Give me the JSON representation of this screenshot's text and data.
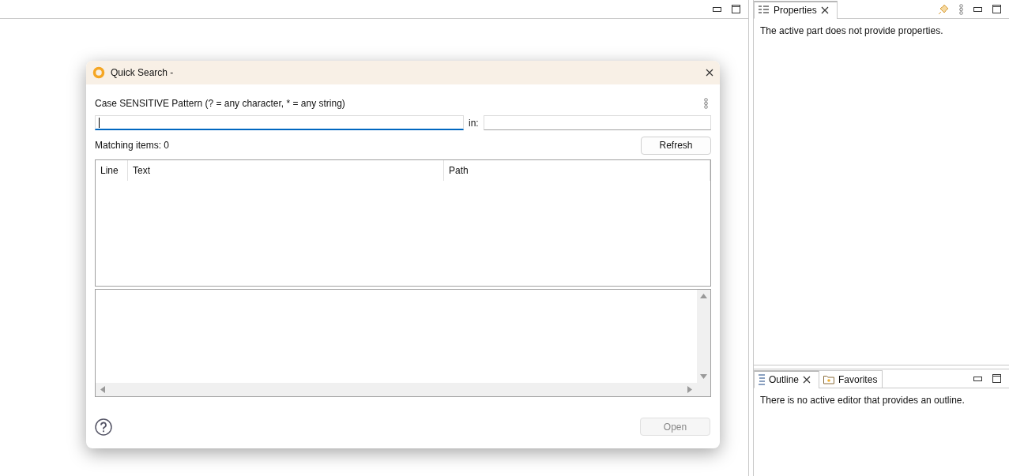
{
  "properties_view": {
    "tabs": [
      {
        "label": "Properties",
        "selected": true
      }
    ],
    "message": "The active part does not provide properties."
  },
  "outline_view": {
    "tabs": [
      {
        "label": "Outline",
        "selected": true,
        "kind": "outline"
      },
      {
        "label": "Favorites",
        "selected": false,
        "kind": "favorites"
      }
    ],
    "message": "There is no active editor that provides an outline."
  },
  "dialog": {
    "title": "Quick Search -",
    "pattern_label": "Case SENSITIVE Pattern (? = any character, * = any string)",
    "pattern_field": {
      "focused": true
    },
    "in_label": "in:",
    "in_field": {
      "focused": false
    },
    "matching": "Matching items: 0",
    "refresh_button": {
      "label": "Refresh",
      "disabled": false
    },
    "table": {
      "columns": [
        "Line",
        "Text",
        "Path"
      ]
    },
    "open_button": {
      "label": "Open",
      "disabled": true
    }
  }
}
